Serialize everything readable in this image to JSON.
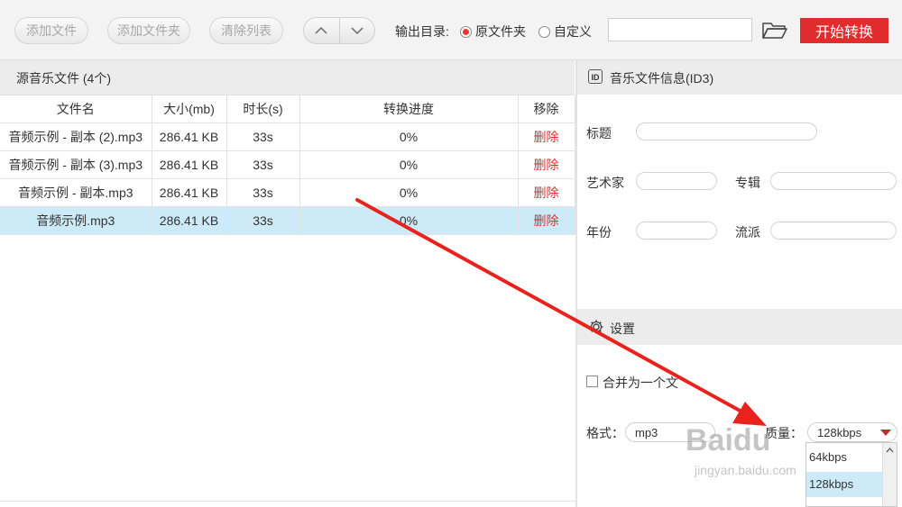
{
  "toolbar": {
    "add_file": "添加文件",
    "add_folder": "添加文件夹",
    "clear_list": "清除列表",
    "output_dir_label": "输出目录:",
    "radio_source": "原文件夹",
    "radio_custom": "自定义",
    "output_path": "",
    "start_button": "开始转换"
  },
  "file_list": {
    "header": "源音乐文件 (4个)",
    "columns": [
      "文件名",
      "大小(mb)",
      "时长(s)",
      "转换进度",
      "移除"
    ],
    "rows": [
      {
        "name": "音频示例 - 副本 (2).mp3",
        "size": "286.41 KB",
        "duration": "33s",
        "progress": "0%",
        "remove": "删除"
      },
      {
        "name": "音频示例 - 副本 (3).mp3",
        "size": "286.41 KB",
        "duration": "33s",
        "progress": "0%",
        "remove": "删除"
      },
      {
        "name": "音频示例 - 副本.mp3",
        "size": "286.41 KB",
        "duration": "33s",
        "progress": "0%",
        "remove": "删除"
      },
      {
        "name": "音频示例.mp3",
        "size": "286.41 KB",
        "duration": "33s",
        "progress": "0%",
        "remove": "删除"
      }
    ],
    "selected_row": 3
  },
  "id3": {
    "header": "音乐文件信息(ID3)",
    "icon_text": "ID",
    "title_label": "标题",
    "artist_label": "艺术家",
    "album_label": "专辑",
    "year_label": "年份",
    "genre_label": "流派"
  },
  "settings": {
    "header": "设置",
    "merge_label": "合并为一个文",
    "format_label": "格式：",
    "format_value": "mp3",
    "quality_label": "质量：",
    "quality_value": "128kbps",
    "quality_options": [
      "64kbps",
      "128kbps"
    ],
    "quality_highlighted": "128kbps"
  },
  "watermark": {
    "brand": "Baidu",
    "url": "jingyan.baidu.com"
  },
  "colors": {
    "accent_red": "#e02c2c",
    "selection_blue": "#cdeaf8",
    "annotation_arrow": "#e8231e"
  },
  "icons": [
    "arrow-up-icon",
    "arrow-down-icon",
    "folder-open-icon",
    "id3-icon",
    "gear-icon",
    "dropdown-triangle-icon"
  ]
}
